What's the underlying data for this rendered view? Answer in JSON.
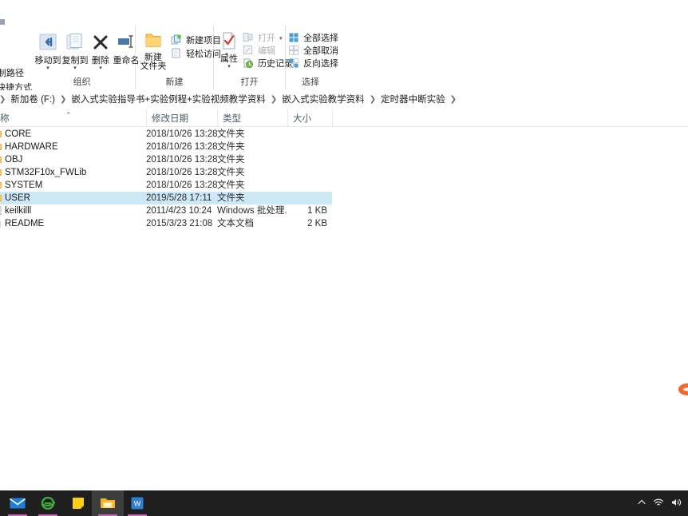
{
  "window": {
    "title": "定时器中断实验"
  },
  "ribbon": {
    "cut_left_items": [
      {
        "label": "复制路径"
      },
      {
        "label": "粘贴快捷方式"
      }
    ],
    "groups": [
      {
        "name": "organize",
        "label": "组织",
        "big_buttons": [
          {
            "label": "移动到",
            "icon": "move-to-icon",
            "has_caret": true
          },
          {
            "label": "复制到",
            "icon": "copy-to-icon",
            "has_caret": true
          },
          {
            "label": "删除",
            "icon": "delete-icon",
            "has_caret": true
          },
          {
            "label": "重命名",
            "icon": "rename-icon",
            "has_caret": false
          }
        ]
      },
      {
        "name": "new",
        "label": "新建",
        "big_buttons": [
          {
            "label": "新建",
            "label2": "文件夹",
            "icon": "new-folder-icon",
            "has_caret": false
          }
        ],
        "small_buttons": [
          {
            "label": "新建项目",
            "icon": "new-item-icon",
            "has_caret": true,
            "disabled": false
          },
          {
            "label": "轻松访问",
            "icon": "easy-access-icon",
            "has_caret": true,
            "disabled": false
          }
        ]
      },
      {
        "name": "open",
        "label": "打开",
        "big_buttons": [
          {
            "label": "属性",
            "icon": "properties-icon",
            "has_caret": true
          }
        ],
        "small_buttons": [
          {
            "label": "打开",
            "icon": "open-icon",
            "has_caret": true,
            "disabled": true
          },
          {
            "label": "编辑",
            "icon": "edit-icon",
            "has_caret": false,
            "disabled": true
          },
          {
            "label": "历史记录",
            "icon": "history-icon",
            "has_caret": false,
            "disabled": false
          }
        ]
      },
      {
        "name": "select",
        "label": "选择",
        "small_buttons": [
          {
            "label": "全部选择",
            "icon": "select-all-icon",
            "has_caret": false,
            "disabled": false
          },
          {
            "label": "全部取消",
            "icon": "select-none-icon",
            "has_caret": false,
            "disabled": false
          },
          {
            "label": "反向选择",
            "icon": "invert-selection-icon",
            "has_caret": false,
            "disabled": false
          }
        ]
      }
    ]
  },
  "address_bar": {
    "crumbs": [
      "新加卷 (F:)",
      "嵌入式实验指导书+实验例程+实验视频教学资料",
      "嵌入式实验教学资料",
      "定时器中断实验"
    ],
    "separator": "❯"
  },
  "file_list": {
    "columns": [
      {
        "label": "称",
        "key": "name",
        "sorted": true,
        "sort_dir": "asc"
      },
      {
        "label": "修改日期",
        "key": "date"
      },
      {
        "label": "类型",
        "key": "type"
      },
      {
        "label": "大小",
        "key": "size"
      }
    ],
    "rows": [
      {
        "name": "CORE",
        "date": "2018/10/26 13:28",
        "type": "文件夹",
        "size": "",
        "icon": "folder-icon",
        "selected": false
      },
      {
        "name": "HARDWARE",
        "date": "2018/10/26 13:28",
        "type": "文件夹",
        "size": "",
        "icon": "folder-icon",
        "selected": false
      },
      {
        "name": "OBJ",
        "date": "2018/10/26 13:28",
        "type": "文件夹",
        "size": "",
        "icon": "folder-icon",
        "selected": false
      },
      {
        "name": "STM32F10x_FWLib",
        "date": "2018/10/26 13:28",
        "type": "文件夹",
        "size": "",
        "icon": "folder-icon",
        "selected": false
      },
      {
        "name": "SYSTEM",
        "date": "2018/10/26 13:28",
        "type": "文件夹",
        "size": "",
        "icon": "folder-icon",
        "selected": false
      },
      {
        "name": "USER",
        "date": "2019/5/28 17:11",
        "type": "文件夹",
        "size": "",
        "icon": "folder-icon",
        "selected": true
      },
      {
        "name": "keilkilll",
        "date": "2011/4/23 10:24",
        "type": "Windows 批处理...",
        "size": "1 KB",
        "icon": "batch-file-icon",
        "selected": false
      },
      {
        "name": "README",
        "date": "2015/3/23 21:08",
        "type": "文本文档",
        "size": "2 KB",
        "icon": "text-file-icon",
        "selected": false
      }
    ]
  },
  "taskbar": {
    "items": [
      {
        "name": "mail-icon",
        "label": "邮件",
        "active": false,
        "running": true
      },
      {
        "name": "internet-explorer-icon",
        "label": "Internet Explorer",
        "active": false,
        "running": true
      },
      {
        "name": "sticky-note-icon",
        "label": "便笺",
        "active": false,
        "running": false
      },
      {
        "name": "file-explorer-icon",
        "label": "文件资源管理器",
        "active": true,
        "running": true
      },
      {
        "name": "wps-icon",
        "label": "WPS Office",
        "active": false,
        "running": true
      }
    ],
    "tray": [
      {
        "name": "show-hidden-icons-icon",
        "glyph": "︿"
      },
      {
        "name": "network-wifi-icon",
        "glyph": "◜"
      },
      {
        "name": "volume-icon",
        "glyph": "◀"
      }
    ]
  },
  "desktop": {
    "stray_icon": {
      "name": "partial-app-icon",
      "color": "#ee6b2f"
    }
  },
  "colors": {
    "selection": "#cce8f6",
    "ribbon_bg": "#ffffff",
    "taskbar_bg": "#1f1f1f",
    "folder_yellow": "#ffc societies"
  }
}
